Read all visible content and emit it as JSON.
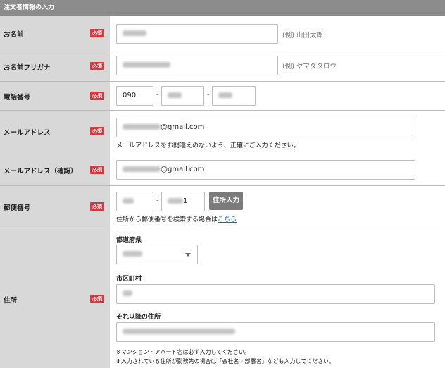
{
  "section_title": "注文者情報の入力",
  "required_label": "必須",
  "name": {
    "label": "お名前",
    "example": "(例) 山田太郎"
  },
  "furigana": {
    "label": "お名前フリガナ",
    "example": "(例) ヤマダタロウ"
  },
  "phone": {
    "label": "電話番号",
    "part1": "090",
    "separator": "-"
  },
  "email": {
    "label": "メールアドレス",
    "value_suffix": "@gmail.com",
    "hint": "メールアドレスをお間違えのないよう、正確にご入力ください。"
  },
  "email_confirm": {
    "label": "メールアドレス（確認）",
    "value_suffix": "@gmail.com"
  },
  "postal": {
    "label": "郵便番号",
    "separator": "-",
    "part2_tail": "1",
    "button": "住所入力",
    "hint_prefix": "住所から郵便番号を検索する場合は",
    "hint_link": "こちら"
  },
  "address": {
    "label": "住所",
    "prefecture_label": "都道府県",
    "city_label": "市区町村",
    "rest_label": "それ以降の住所",
    "note1": "※マンション・アパート名は必ず入力してください。",
    "note2": "※入力されている住所が勤務先の場合は「会社名・部署名」なども入力してください。"
  },
  "icons": {
    "select_arrow": "chevron-down-icon"
  }
}
